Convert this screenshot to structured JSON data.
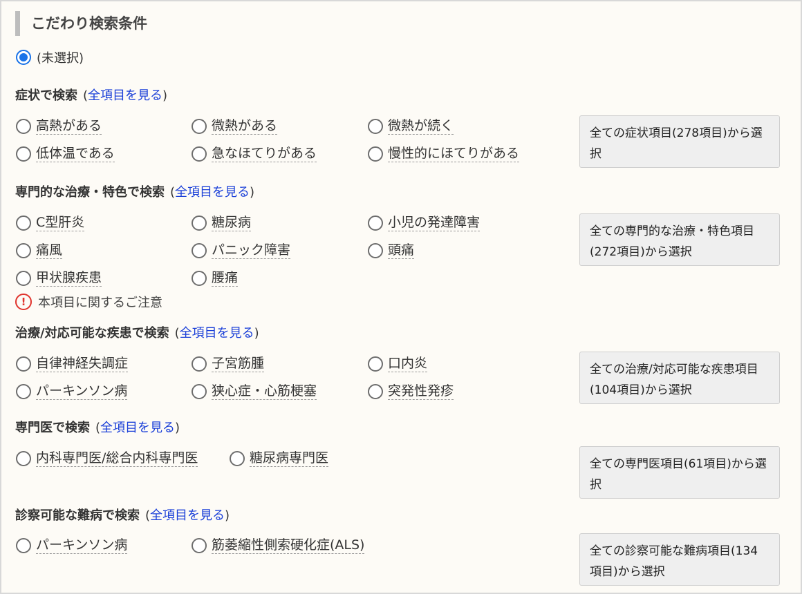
{
  "title": "こだわり検索条件",
  "unselected": "(未選択)",
  "see_all": "全項目を見る",
  "sections": [
    {
      "heading": "症状で検索",
      "options": [
        "高熱がある",
        "微熱がある",
        "微熱が続く",
        "低体温である",
        "急なほてりがある",
        "慢性的にほてりがある"
      ],
      "all_button": "全ての症状項目(278項目)から選択"
    },
    {
      "heading": "専門的な治療・特色で検索",
      "options": [
        "C型肝炎",
        "糖尿病",
        "小児の発達障害",
        "痛風",
        "パニック障害",
        "頭痛",
        "甲状腺疾患",
        "腰痛"
      ],
      "all_button": "全ての専門的な治療・特色項目(272項目)から選択",
      "notice": "本項目に関するご注意"
    },
    {
      "heading": "治療/対応可能な疾患で検索",
      "options": [
        "自律神経失調症",
        "子宮筋腫",
        "口内炎",
        "パーキンソン病",
        "狭心症・心筋梗塞",
        "突発性発疹"
      ],
      "all_button": "全ての治療/対応可能な疾患項目(104項目)から選択"
    },
    {
      "heading": "専門医で検索",
      "options": [
        "内科専門医/総合内科専門医",
        "糖尿病専門医"
      ],
      "all_button": "全ての専門医項目(61項目)から選択"
    },
    {
      "heading": "診察可能な難病で検索",
      "options": [
        "パーキンソン病",
        "筋萎縮性側索硬化症(ALS)"
      ],
      "all_button": "全ての診察可能な難病項目(134項目)から選択"
    }
  ]
}
